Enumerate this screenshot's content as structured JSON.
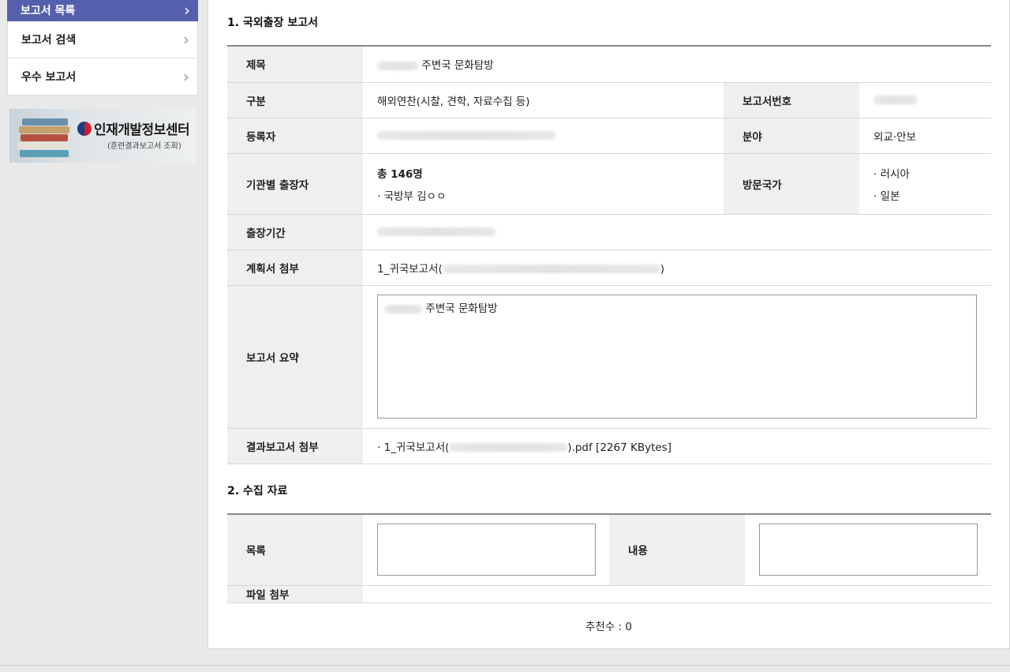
{
  "sidebar": {
    "items": [
      {
        "label": "보고서 목록",
        "active": true
      },
      {
        "label": "보고서 검색",
        "active": false
      },
      {
        "label": "우수 보고서",
        "active": false
      }
    ],
    "banner": {
      "title": "인재개발정보센터",
      "subtitle": "(훈련결과보고서 조회)"
    }
  },
  "section1": {
    "title": "1. 국외출장 보고서",
    "rows": {
      "title_label": "제목",
      "title_value": "주변국 문화탐방",
      "category_label": "구분",
      "category_value": "해외연찬(시찰, 견학, 자료수집 등)",
      "report_no_label": "보고서번호",
      "registrant_label": "등록자",
      "field_label": "분야",
      "field_value": "외교·안보",
      "travelers_label": "기관별 출장자",
      "travelers_total": "총 146명",
      "travelers_detail": "· 국방부  김ㅇㅇ",
      "countries_label": "방문국가",
      "countries": [
        "· 러시아",
        "· 일본"
      ],
      "period_label": "출장기간",
      "plan_attach_label": "계획서 첨부",
      "plan_attach_prefix": "1_귀국보고서(",
      "plan_attach_suffix": ")",
      "summary_label": "보고서 요약",
      "summary_value": "주변국 문화탐방",
      "result_attach_label": "결과보고서 첨부",
      "result_attach_prefix": "· 1_귀국보고서(",
      "result_attach_suffix": ").pdf",
      "result_attach_size": "[2267 KBytes]"
    }
  },
  "section2": {
    "title": "2. 수집 자료",
    "list_label": "목록",
    "content_label": "내용",
    "file_label": "파일 첨부"
  },
  "footer": {
    "recommend": "추천수 : 0"
  }
}
